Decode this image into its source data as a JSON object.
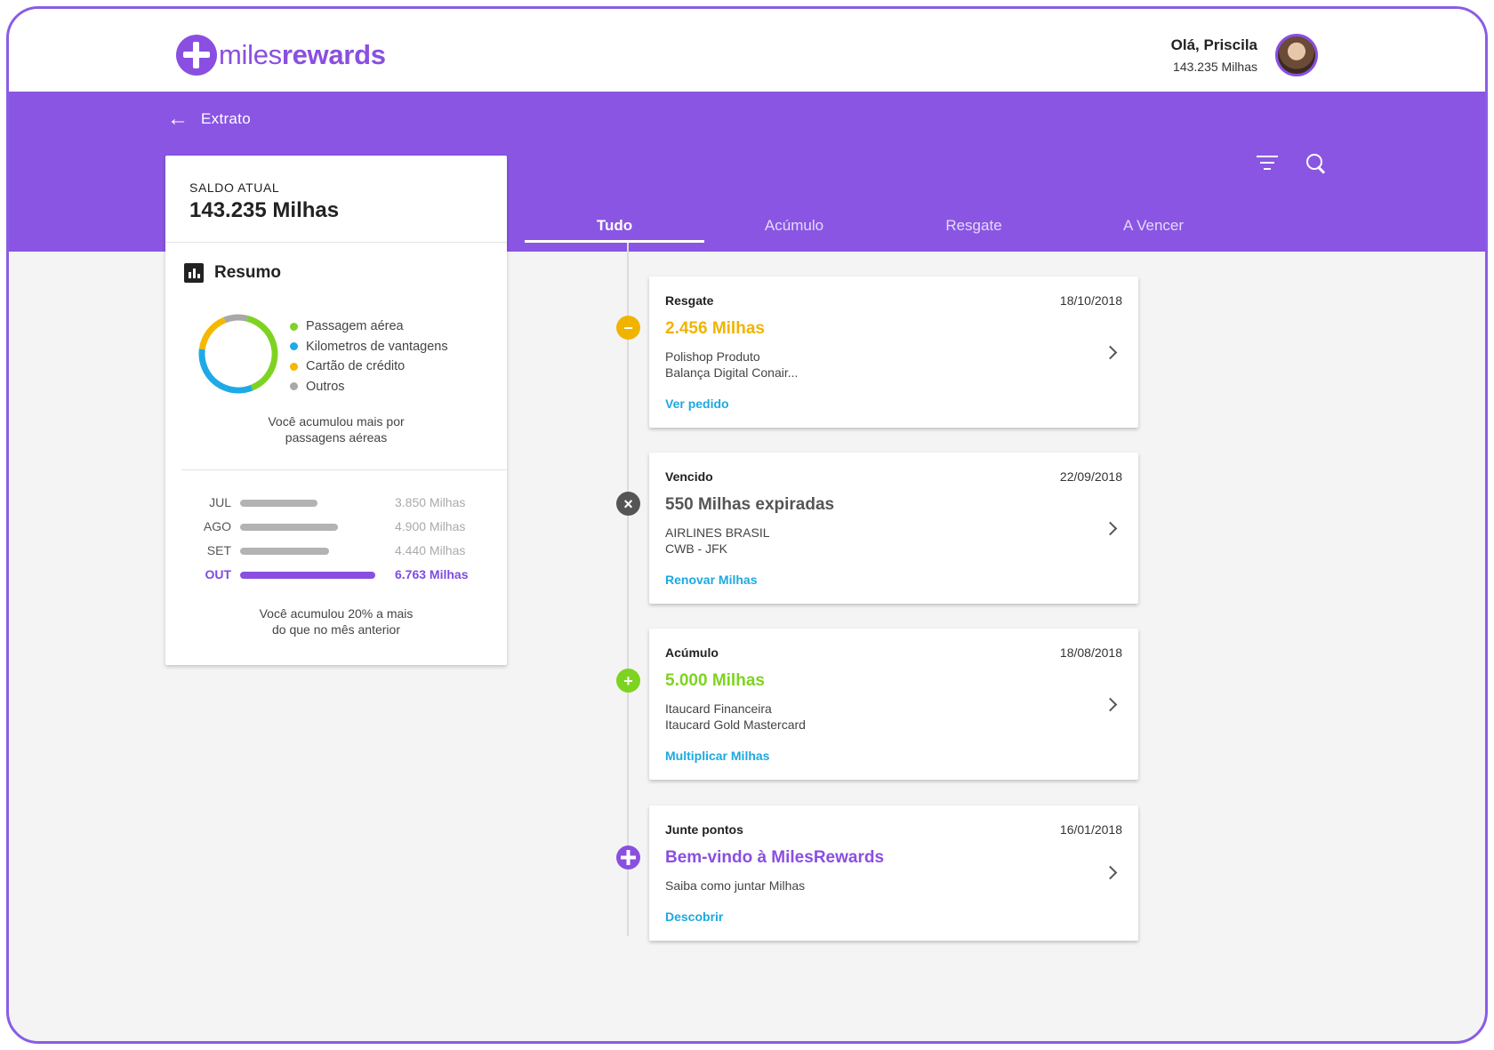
{
  "brand": {
    "name_light": "miles",
    "name_bold": "rewards",
    "color": "#8a4fe0"
  },
  "user": {
    "greeting": "Olá, Priscila",
    "miles": "143.235 Milhas"
  },
  "page": {
    "back_label": "Extrato"
  },
  "toolbar": {
    "filter_icon": "filter-icon",
    "search_icon": "search-icon"
  },
  "tabs": [
    {
      "label": "Tudo",
      "active": true
    },
    {
      "label": "Acúmulo",
      "active": false
    },
    {
      "label": "Resgate",
      "active": false
    },
    {
      "label": "A Vencer",
      "active": false
    }
  ],
  "balance": {
    "label": "SALDO ATUAL",
    "value": "143.235 Milhas"
  },
  "summary": {
    "title": "Resumo",
    "legend": [
      {
        "label": "Passagem aérea",
        "color": "#7ed321",
        "share": 0.4
      },
      {
        "label": "Kilometros de vantagens",
        "color": "#1eaae7",
        "share": 0.33
      },
      {
        "label": "Cartão de crédito",
        "color": "#f5b800",
        "share": 0.17
      },
      {
        "label": "Outros",
        "color": "#a8a8a8",
        "share": 0.1
      }
    ],
    "donut_caption_1": "Você acumulou mais por",
    "donut_caption_2": "passagens aéreas",
    "months": [
      {
        "month": "JUL",
        "value": 3850,
        "label": "3.850 Milhas",
        "current": false
      },
      {
        "month": "AGO",
        "value": 4900,
        "label": "4.900 Milhas",
        "current": false
      },
      {
        "month": "SET",
        "value": 4440,
        "label": "4.440 Milhas",
        "current": false
      },
      {
        "month": "OUT",
        "value": 6763,
        "label": "6.763 Milhas",
        "current": true
      }
    ],
    "bars_caption_1": "Você acumulou 20% a mais",
    "bars_caption_2": "do que no mês anterior"
  },
  "transactions": [
    {
      "type": "Resgate",
      "date": "18/10/2018",
      "amount": "2.456 Milhas",
      "amount_color": "#f0b400",
      "desc1": "Polishop Produto",
      "desc2": "Balança Digital Conair...",
      "link": "Ver pedido",
      "marker": "minus-icon",
      "marker_color": "#f0b400"
    },
    {
      "type": "Vencido",
      "date": "22/09/2018",
      "amount": "550 Milhas expiradas",
      "amount_color": "#555555",
      "desc1": "AIRLINES BRASIL",
      "desc2": "CWB - JFK",
      "link": "Renovar Milhas",
      "marker": "close-icon",
      "marker_color": "#555555"
    },
    {
      "type": "Acúmulo",
      "date": "18/08/2018",
      "amount": "5.000 Milhas",
      "amount_color": "#7ed321",
      "desc1": "Itaucard Financeira",
      "desc2": "Itaucard Gold Mastercard",
      "link": "Multiplicar Milhas",
      "marker": "plus-icon",
      "marker_color": "#7ed321"
    },
    {
      "type": "Junte pontos",
      "date": "16/01/2018",
      "amount": "Bem-vindo à MilesRewards",
      "amount_color": "#8a4fe0",
      "desc1": "Saiba como juntar Milhas",
      "desc2": "",
      "link": "Descobrir",
      "marker": "brand-icon",
      "marker_color": "#8a4fe0"
    }
  ],
  "link_color": "#1ea8df"
}
